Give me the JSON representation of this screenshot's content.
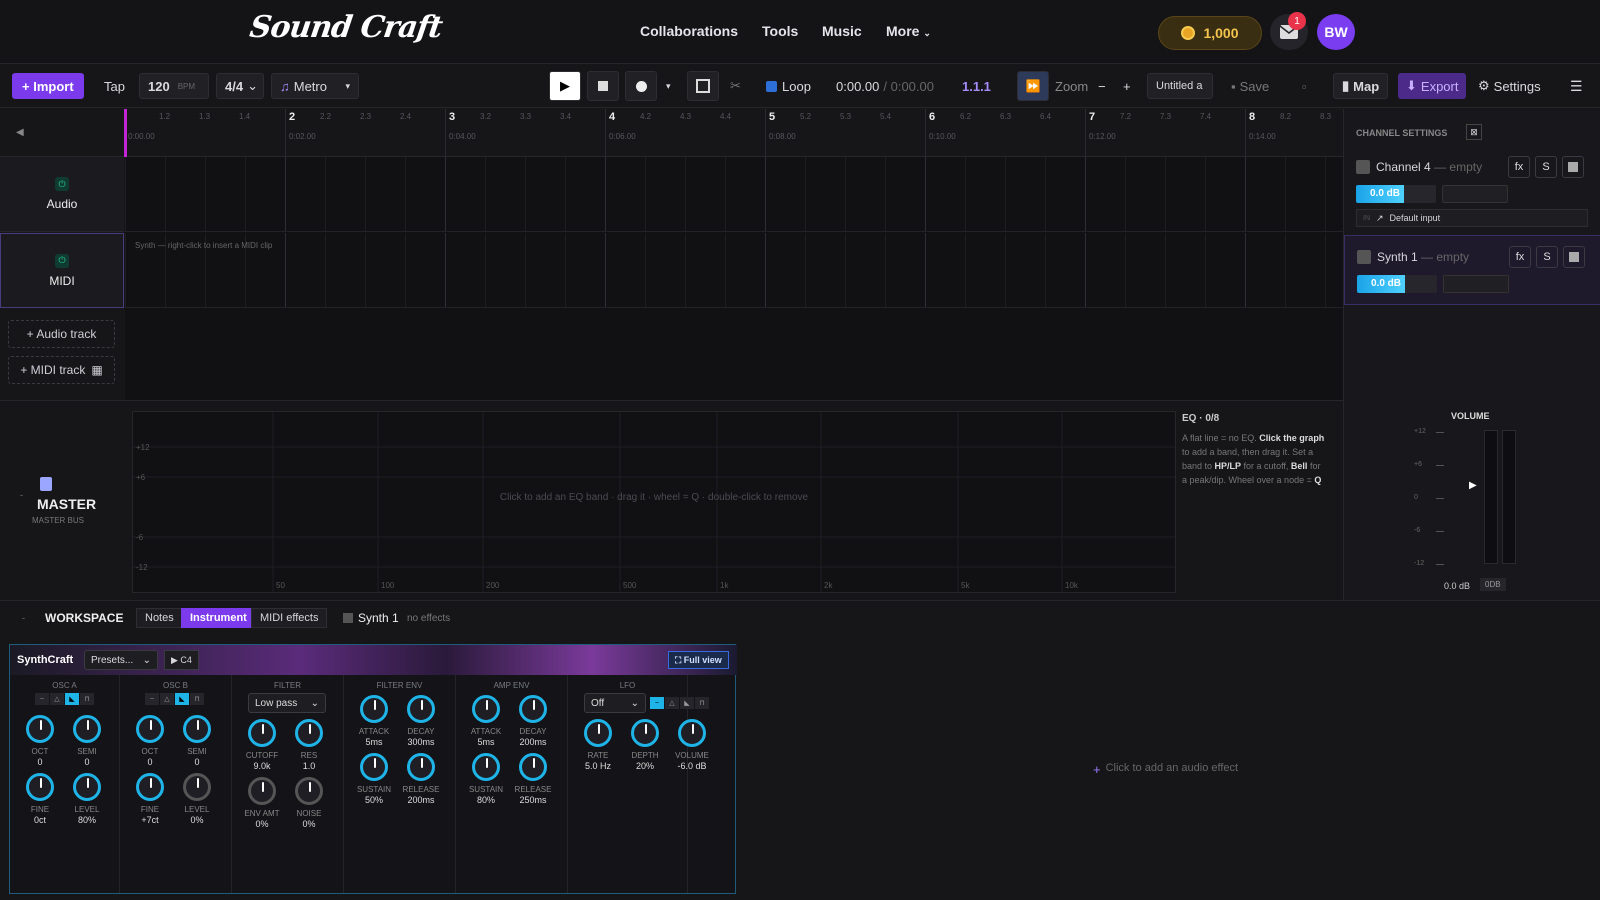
{
  "nav": {
    "logo": "Sound Craft",
    "links": [
      "Collaborations",
      "Tools",
      "Music",
      "More"
    ],
    "coins": "1,000",
    "mail_count": "1",
    "avatar": "BW"
  },
  "toolbar": {
    "import": "+ Import",
    "tap": "Tap",
    "bpm": "120",
    "bpm_unit": "BPM",
    "meter": "4/4",
    "metro": "Metro",
    "loop": "Loop",
    "time": "0:00.00",
    "time_total": "/ 0:00.00",
    "position": "1.1.1",
    "zoom": "Zoom",
    "zoom_minus": "−",
    "zoom_plus": "+",
    "project": "Untitled a",
    "save": "Save",
    "map": "Map",
    "export": "Export",
    "settings": "Settings"
  },
  "ruler": {
    "bars": [
      {
        "n": "2",
        "t": "0:02.00",
        "s": [
          "2.2",
          "2.3",
          "2.4"
        ]
      },
      {
        "n": "3",
        "t": "0:04.00",
        "s": [
          "3.2",
          "3.3",
          "3.4"
        ]
      },
      {
        "n": "4",
        "t": "0:06.00",
        "s": [
          "4.2",
          "4.3",
          "4.4"
        ]
      },
      {
        "n": "5",
        "t": "0:08.00",
        "s": [
          "5.2",
          "5.3",
          "5.4"
        ]
      },
      {
        "n": "6",
        "t": "0:10.00",
        "s": [
          "6.2",
          "6.3",
          "6.4"
        ]
      },
      {
        "n": "7",
        "t": "0:12.00",
        "s": [
          "7.2",
          "7.3",
          "7.4"
        ]
      },
      {
        "n": "8",
        "t": "0:14.00",
        "s": [
          "8.2",
          "8.3"
        ]
      }
    ],
    "first": {
      "t": "0:00.00",
      "s": [
        "1.2",
        "1.3",
        "1.4"
      ]
    }
  },
  "tracks": {
    "audio": "Audio",
    "midi": "MIDI",
    "midi_hint": "Synth — right-click to insert a MIDI clip",
    "add_audio": "+ Audio track",
    "add_midi": "+ MIDI track"
  },
  "channel": {
    "title": "CHANNEL SETTINGS",
    "ch4_name": "Channel 4",
    "ch4_status": "— empty",
    "ch4_db": "0.0 dB",
    "input_label": "IN",
    "input": "Default input",
    "synth_name": "Synth 1",
    "synth_status": "— empty",
    "synth_db": "0.0 dB",
    "fx": "fx",
    "solo": "S"
  },
  "master": {
    "title": "MASTER",
    "subtitle": "MASTER BUS",
    "eq_hint": "Click to add an EQ band · drag it · wheel = Q · double-click to remove",
    "eq_title": "EQ · 0/8",
    "eq_help_1": "A flat line = no EQ. ",
    "eq_help_b1": "Click the graph",
    "eq_help_2": " to add a band, then drag it. Set a band to ",
    "eq_help_b2": "HP/LP",
    "eq_help_3": " for a cutoff, ",
    "eq_help_b3": "Bell",
    "eq_help_4": " for a peak/dip. Wheel over a node = ",
    "eq_help_b4": "Q",
    "db_ticks": [
      "+12",
      "+6",
      "-6",
      "-12"
    ],
    "freq_ticks": [
      "50",
      "100",
      "200",
      "500",
      "1k",
      "2k",
      "5k",
      "10k"
    ],
    "volume": "VOLUME",
    "vol_ticks": [
      "+12",
      "+6",
      "0",
      "-6",
      "-12"
    ],
    "vol_db": "0.0 dB",
    "vol_btn": "0DB"
  },
  "workspace": {
    "title": "WORKSPACE",
    "tabs": [
      "Notes",
      "Instrument",
      "MIDI effects"
    ],
    "track": "Synth 1",
    "effects": "no effects",
    "add_effect": "Click to add an audio effect"
  },
  "synth": {
    "name": "SynthCraft",
    "presets": "Presets...",
    "note": "▶ C4",
    "full": "⛶ Full view",
    "osca": {
      "title": "OSC A",
      "knobs": [
        {
          "l": "OCT",
          "v": "0"
        },
        {
          "l": "SEMI",
          "v": "0"
        },
        {
          "l": "FINE",
          "v": "0ct"
        },
        {
          "l": "LEVEL",
          "v": "80%"
        }
      ]
    },
    "oscb": {
      "title": "OSC B",
      "knobs": [
        {
          "l": "OCT",
          "v": "0"
        },
        {
          "l": "SEMI",
          "v": "0"
        },
        {
          "l": "FINE",
          "v": "+7ct"
        },
        {
          "l": "LEVEL",
          "v": "0%"
        }
      ]
    },
    "filter": {
      "title": "FILTER",
      "type": "Low pass",
      "knobs": [
        {
          "l": "CUTOFF",
          "v": "9.0k"
        },
        {
          "l": "RES",
          "v": "1.0"
        },
        {
          "l": "ENV AMT",
          "v": "0%"
        },
        {
          "l": "NOISE",
          "v": "0%"
        }
      ]
    },
    "fenv": {
      "title": "FILTER ENV",
      "knobs": [
        {
          "l": "ATTACK",
          "v": "5ms"
        },
        {
          "l": "DECAY",
          "v": "300ms"
        },
        {
          "l": "SUSTAIN",
          "v": "50%"
        },
        {
          "l": "RELEASE",
          "v": "200ms"
        }
      ]
    },
    "aenv": {
      "title": "AMP ENV",
      "knobs": [
        {
          "l": "ATTACK",
          "v": "5ms"
        },
        {
          "l": "DECAY",
          "v": "200ms"
        },
        {
          "l": "SUSTAIN",
          "v": "80%"
        },
        {
          "l": "RELEASE",
          "v": "250ms"
        }
      ]
    },
    "lfo": {
      "title": "LFO",
      "mode": "Off",
      "knobs": [
        {
          "l": "RATE",
          "v": "5.0 Hz"
        },
        {
          "l": "DEPTH",
          "v": "20%"
        },
        {
          "l": "VOLUME",
          "v": "-6.0 dB"
        }
      ]
    }
  },
  "colors": {
    "accent": "#7c3aed",
    "cyan": "#1fb4e8",
    "eq_line_start": "#4fb6ff",
    "eq_line_end": "#e040c0"
  },
  "icons": {
    "play": "play-icon",
    "stop": "stop-icon",
    "record": "record-icon",
    "scissors": "scissors-icon",
    "mail": "mail-icon",
    "coin": "coin-icon"
  }
}
